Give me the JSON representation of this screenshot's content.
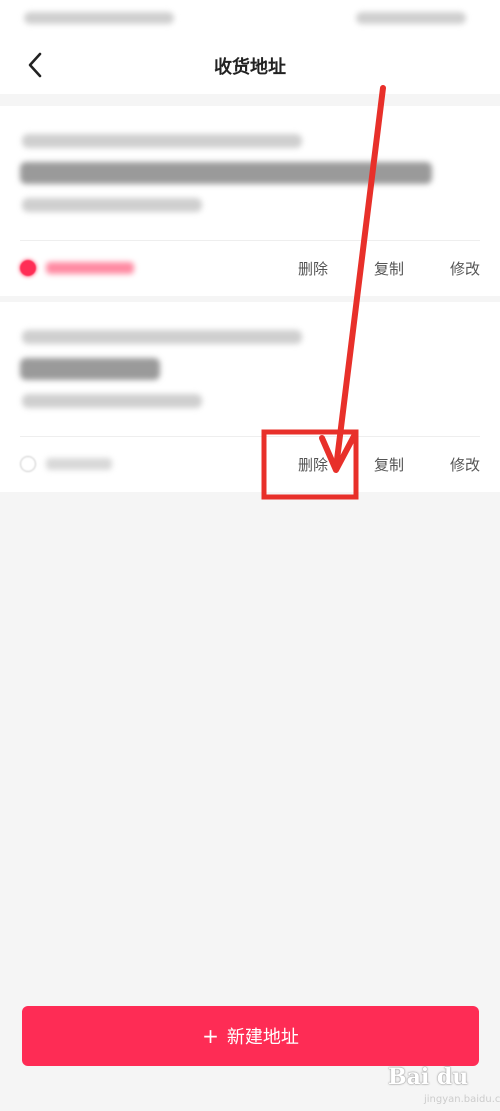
{
  "header": {
    "title": "收货地址",
    "back_icon": "chevron-left-icon"
  },
  "addresses": [
    {
      "is_default": true,
      "actions": {
        "delete": "删除",
        "copy": "复制",
        "edit": "修改"
      }
    },
    {
      "is_default": false,
      "actions": {
        "delete": "删除",
        "copy": "复制",
        "edit": "修改"
      }
    }
  ],
  "footer": {
    "new_address_label": "新建地址",
    "plus_icon": "+"
  },
  "colors": {
    "accent": "#fe2c55",
    "annotation": "#e8302a"
  },
  "watermark": {
    "logo": "Bai du",
    "sub": "jingyan.baidu.com"
  }
}
